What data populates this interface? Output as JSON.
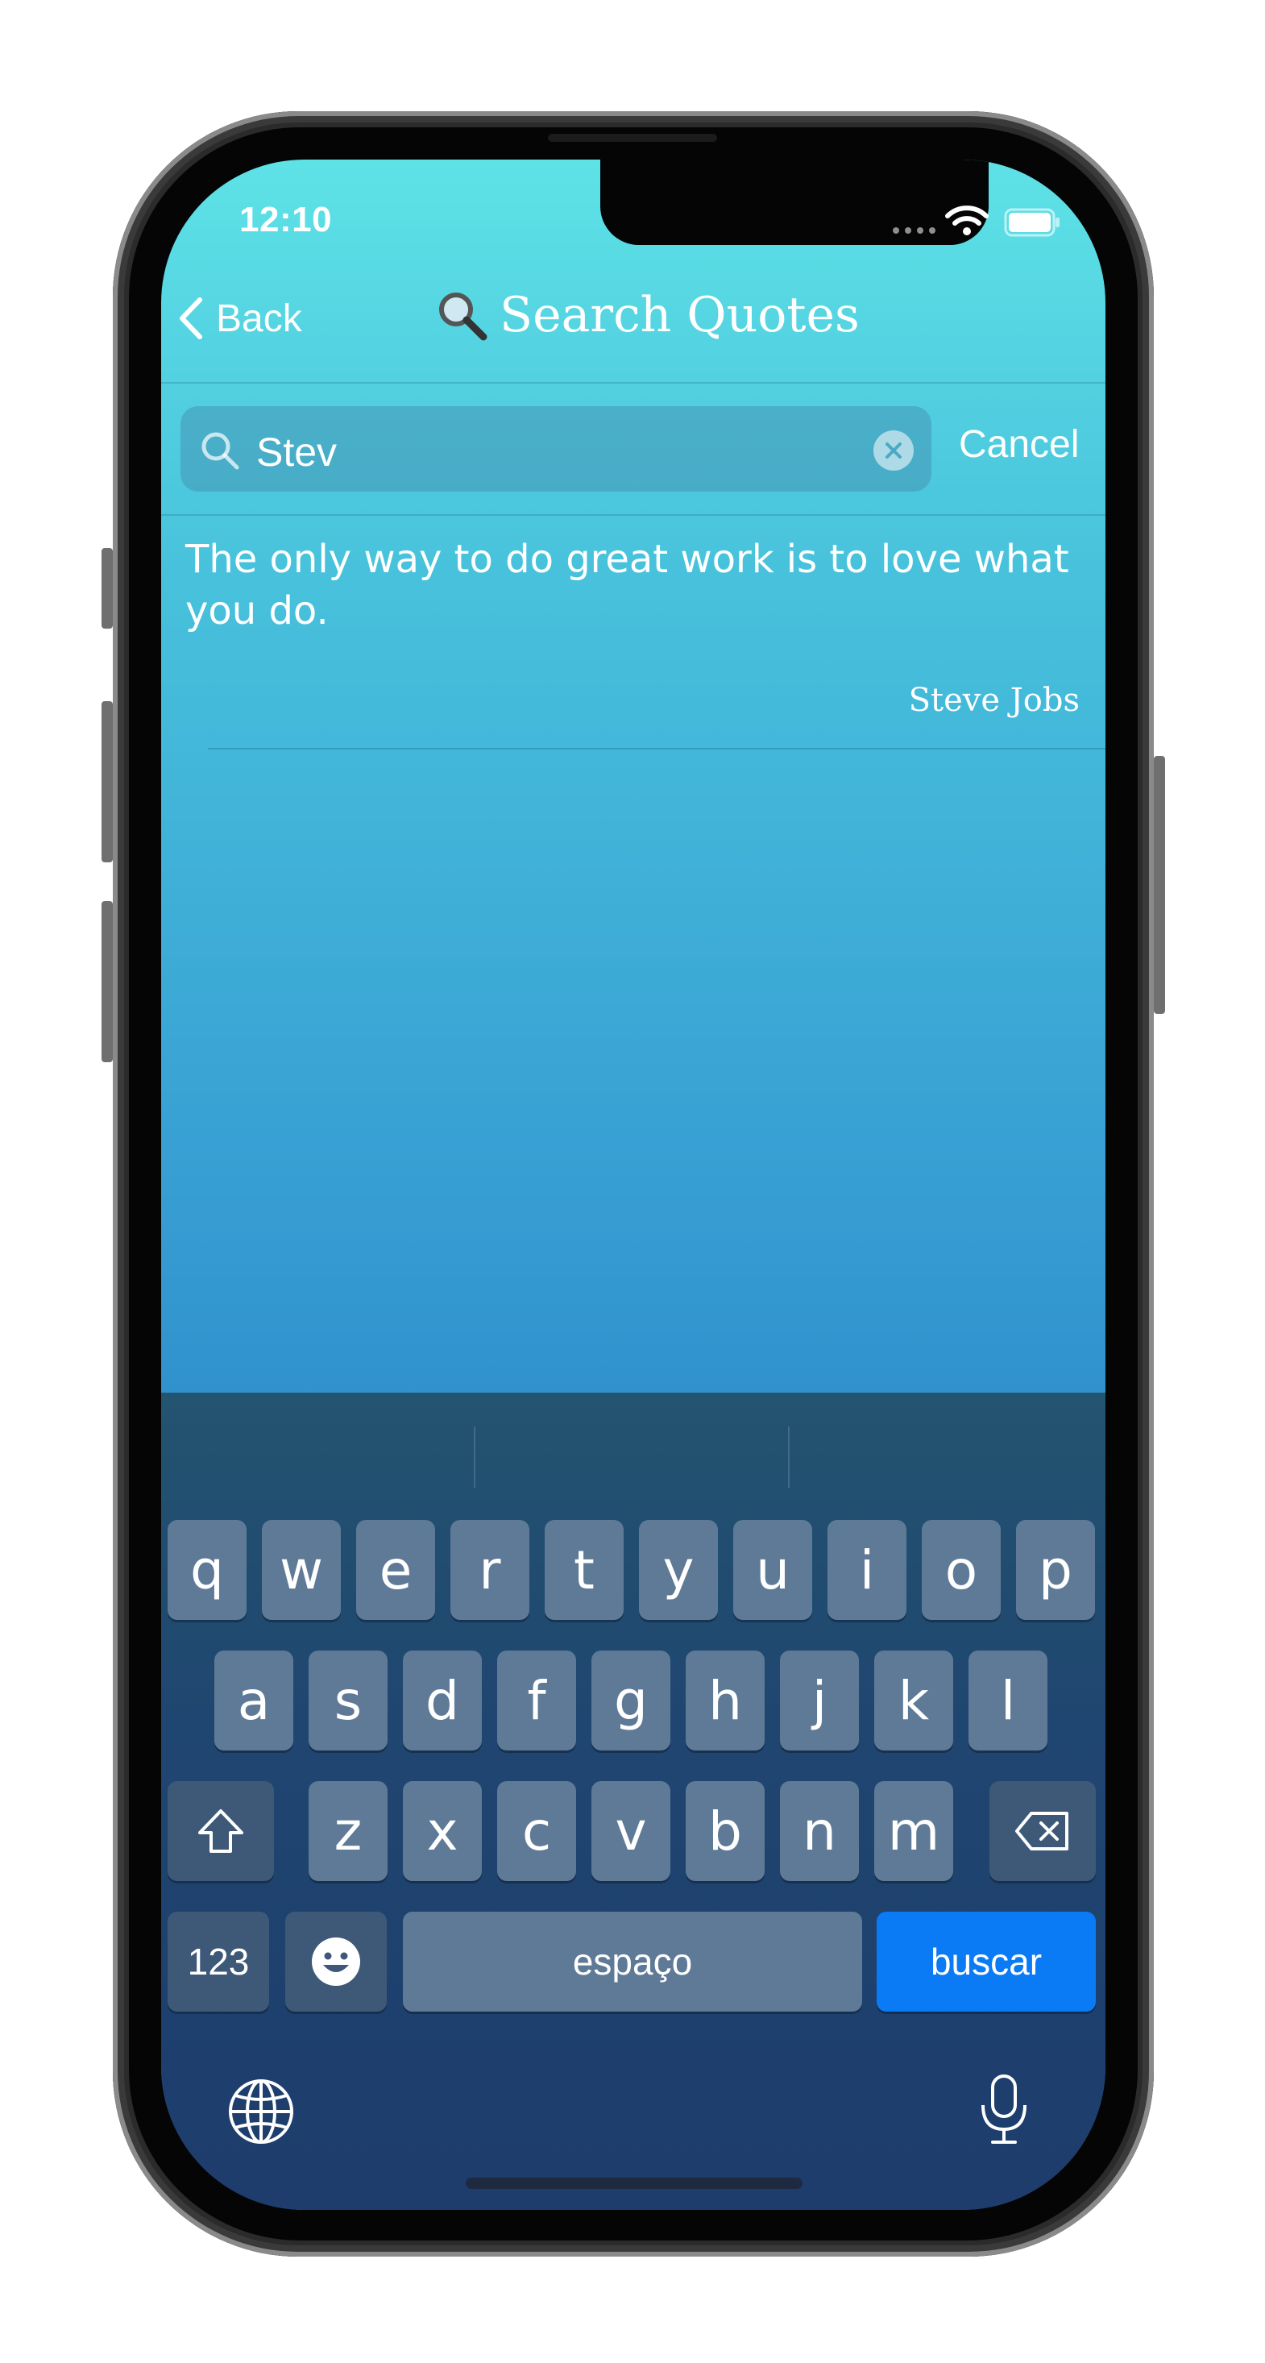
{
  "status_bar": {
    "time": "12:10"
  },
  "nav": {
    "back_label": "Back",
    "title_icon": "🔍",
    "title": "Search Quotes"
  },
  "search": {
    "value": "Stev",
    "cancel_label": "Cancel"
  },
  "results": [
    {
      "quote": "The only way to do great work is to love what you do.",
      "author": "Steve Jobs"
    }
  ],
  "keyboard": {
    "row1": [
      "q",
      "w",
      "e",
      "r",
      "t",
      "y",
      "u",
      "i",
      "o",
      "p"
    ],
    "row2": [
      "a",
      "s",
      "d",
      "f",
      "g",
      "h",
      "j",
      "k",
      "l"
    ],
    "row3": [
      "z",
      "x",
      "c",
      "v",
      "b",
      "n",
      "m"
    ],
    "numbers_label": "123",
    "space_label": "espaço",
    "return_label": "buscar"
  },
  "colors": {
    "accent_blue": "#0a7bf5",
    "header_top": "#5ee2e6",
    "body_bottom": "#2a86c8"
  }
}
